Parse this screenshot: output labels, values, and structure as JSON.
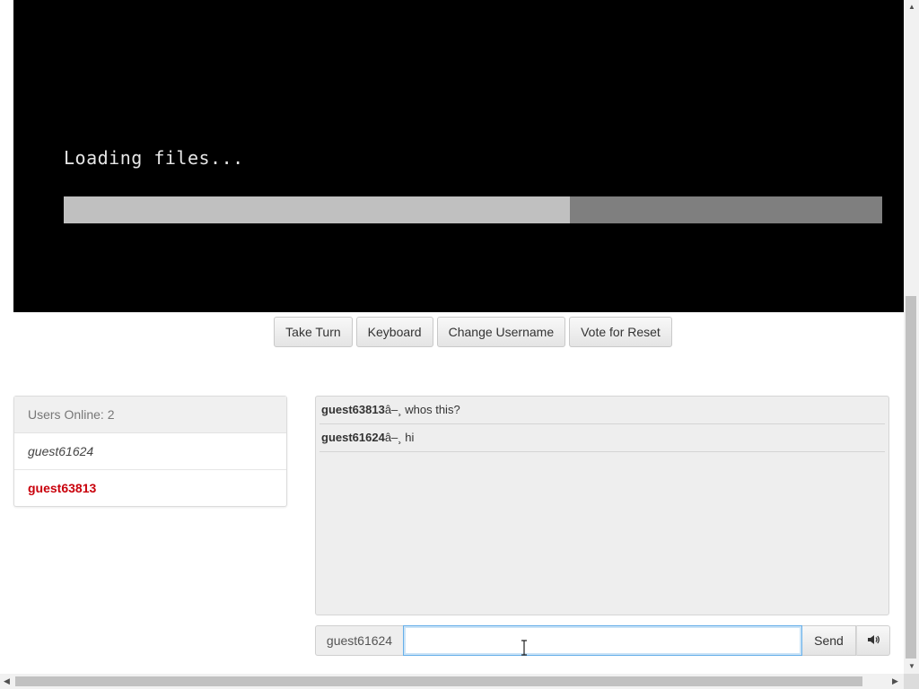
{
  "vm": {
    "loading_text": "Loading files...",
    "progress": 0.618
  },
  "toolbar": {
    "take_turn": "Take Turn",
    "keyboard": "Keyboard",
    "change_username": "Change Username",
    "vote_reset": "Vote for Reset"
  },
  "users": {
    "header": "Users Online: 2",
    "list": [
      {
        "name": "guest61624"
      },
      {
        "name": "guest63813"
      }
    ]
  },
  "chat": {
    "messages": [
      {
        "user": "guest63813",
        "sep": "â–¸",
        "text": "whos this?"
      },
      {
        "user": "guest61624",
        "sep": "â–¸",
        "text": "hi"
      }
    ],
    "username": "guest61624",
    "input_value": "",
    "send_label": "Send",
    "sound_icon": "speaker-icon"
  },
  "colors": {
    "self_user": "#c9000b",
    "progress_fill": "#c0c0c0",
    "progress_track": "#7f7f7f",
    "focus": "#66afe9"
  }
}
